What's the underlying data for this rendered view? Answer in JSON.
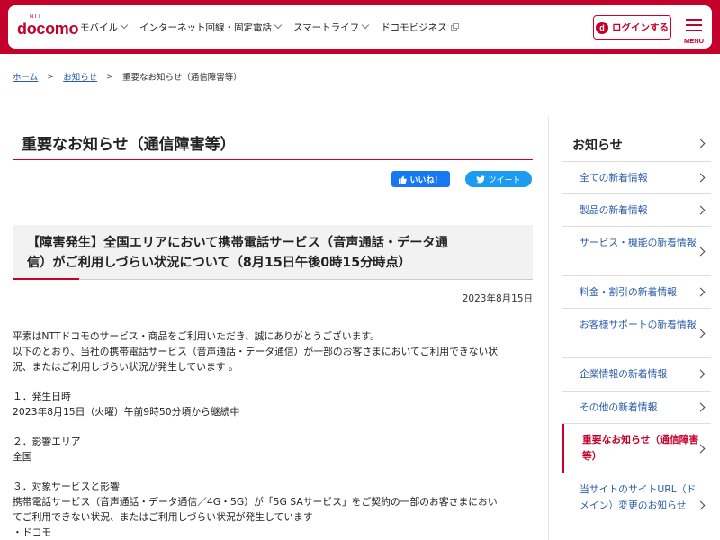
{
  "header": {
    "logo_small": "NTT",
    "logo": "docomo",
    "nav": [
      {
        "label": "モバイル",
        "marker": "chevron"
      },
      {
        "label": "インターネット回線・固定電話",
        "marker": "chevron"
      },
      {
        "label": "スマートライフ",
        "marker": "chevron"
      },
      {
        "label": "ドコモビジネス",
        "marker": "external"
      }
    ],
    "login_icon": "d",
    "login_label": "ログインする",
    "menu_label": "MENU"
  },
  "breadcrumb": {
    "home": "ホーム",
    "news": "お知らせ",
    "current": "重要なお知らせ（通信障害等）",
    "sep": ">"
  },
  "article": {
    "page_title": "重要なお知らせ（通信障害等）",
    "like_label": "いいね！",
    "tweet_label": "ツイート",
    "headline_line1": "【障害発生】全国エリアにおいて携帯電話サービス（音声通話・データ通",
    "headline_line2": "信）がご利用しづらい状況について（8月15日午後0時15分時点）",
    "date": "2023年8月15日",
    "p1": "平素はNTTドコモのサービス・商品をご利用いただき、誠にありがとうございます。",
    "p2_line1": "以下のとおり、当社の携帯電話サービス（音声通話・データ通信）が一部のお客さまにおいてご利用できない状",
    "p2_line2": "況、またはご利用しづらい状況が発生しています 。",
    "s1_head": "１．発生日時",
    "s1_body": "2023年8月15日（火曜）午前9時50分頃から継続中",
    "s2_head": "２．影響エリア",
    "s2_body": "全国",
    "s3_head": "３．対象サービスと影響",
    "s3_line1": "携帯電話サービス（音声通話・データ通信／4G・5G）が「5G SAサービス」をご契約の一部のお客さまにおい",
    "s3_line2": "てご利用できない状況、またはご利用しづらい状況が発生しています",
    "s3_line3": "・ドコモ"
  },
  "sidebar": {
    "title": "お知らせ",
    "items": [
      {
        "label": "全ての新着情報"
      },
      {
        "label": "製品の新着情報"
      },
      {
        "label": "サービス・機能の新着情報"
      },
      {
        "label": "料金・割引の新着情報"
      },
      {
        "label": "お客様サポートの新着情報"
      },
      {
        "label": "企業情報の新着情報"
      },
      {
        "label": "その他の新着情報"
      },
      {
        "label": "重要なお知らせ（通信障害等）",
        "active": true
      },
      {
        "label": "当サイトのサイトURL（ドメイン）変更のお知らせ"
      }
    ]
  },
  "colors": {
    "brand": "#c4012a",
    "link": "#2a5caa",
    "facebook": "#1877f2",
    "twitter": "#1d9bf0"
  }
}
